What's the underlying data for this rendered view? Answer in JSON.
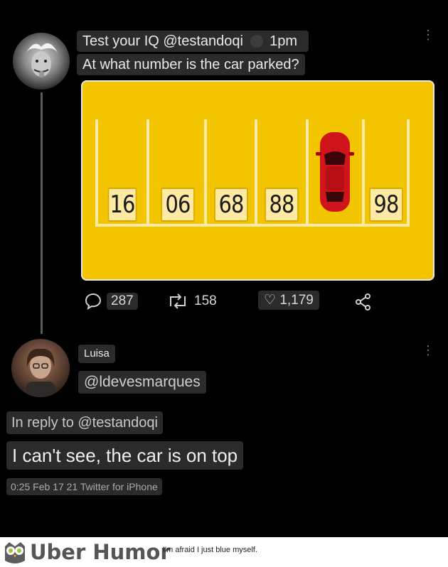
{
  "tweet": {
    "header": "Test your IQ @testandoqi",
    "time": "1pm",
    "text": "At what number is the car parked?",
    "puzzle_numbers": [
      "16",
      "06",
      "68",
      "88",
      "98"
    ],
    "replies": "287",
    "retweets": "158",
    "likes": "1,179",
    "icons": {
      "reply": "comment-icon",
      "retweet": "retweet-icon",
      "like": "heart-icon",
      "share": "share-icon",
      "more": "more-vertical-icon"
    }
  },
  "reply": {
    "name": "Luisa",
    "handle": "@ldevesmarques",
    "in_reply_to": "In reply to @testandoqi",
    "text": "I can't see, the car is on top",
    "meta": "0:25 Feb 17 21 Twitter for iPhone"
  },
  "footer": {
    "brand": "Uber Humor",
    "caption": "I'm afraid I just blue myself."
  }
}
